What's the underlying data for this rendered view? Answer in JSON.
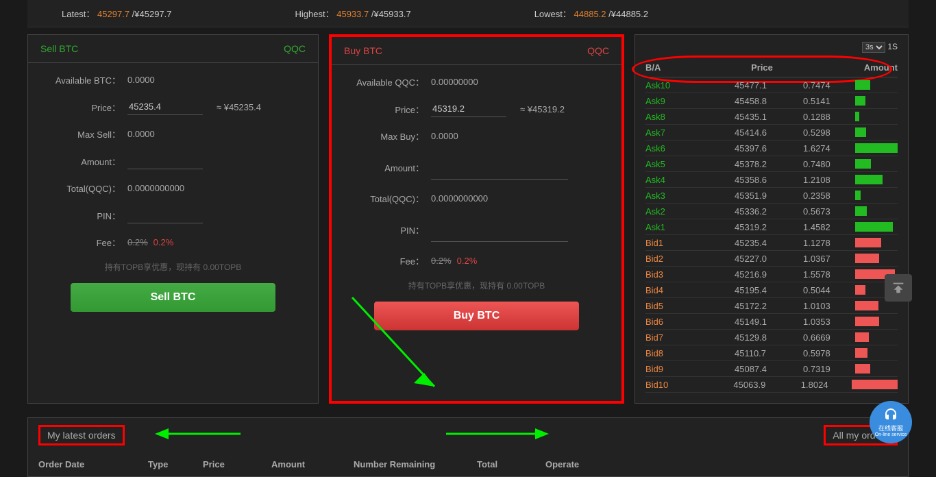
{
  "stats": {
    "latest_label": "Latest：",
    "latest_val": "45297.7",
    "latest_sub": "/¥45297.7",
    "highest_label": "Highest：",
    "highest_val": "45933.7",
    "highest_sub": "/¥45933.7",
    "lowest_label": "Lowest：",
    "lowest_val": "44885.2",
    "lowest_sub": "/¥44885.2"
  },
  "sell": {
    "title": "Sell BTC",
    "currency": "QQC",
    "available_label": "Available BTC：",
    "available_val": "0.0000",
    "price_label": "Price：",
    "price_val": "45235.4",
    "price_approx": "≈ ¥45235.4",
    "max_label": "Max Sell：",
    "max_val": "0.0000",
    "amount_label": "Amount：",
    "amount_val": "",
    "total_label": "Total(QQC)：",
    "total_val": "0.0000000000",
    "pin_label": "PIN：",
    "pin_val": "",
    "fee_label": "Fee：",
    "fee_strike": "0.2%",
    "fee_val": "0.2%",
    "note": "持有TOPB享优惠，现持有 0.00TOPB",
    "btn": "Sell BTC"
  },
  "buy": {
    "title": "Buy BTC",
    "currency": "QQC",
    "available_label": "Available QQC：",
    "available_val": "0.00000000",
    "price_label": "Price：",
    "price_val": "45319.2",
    "price_approx": "≈ ¥45319.2",
    "max_label": "Max Buy：",
    "max_val": "0.0000",
    "amount_label": "Amount：",
    "amount_val": "",
    "total_label": "Total(QQC)：",
    "total_val": "0.0000000000",
    "pin_label": "PIN：",
    "pin_val": "",
    "fee_label": "Fee：",
    "fee_strike": "0.2%",
    "fee_val": "0.2%",
    "note": "持有TOPB享优惠，现持有 0.00TOPB",
    "btn": "Buy BTC"
  },
  "orderbook": {
    "refresh": "3s",
    "refresh_suffix": "1S",
    "h1": "B/A",
    "h2": "Price",
    "h3": "Amount",
    "rows": [
      {
        "label": "Ask10",
        "price": "45477.1",
        "amount": "0.7474",
        "side": "ask",
        "bar": 22
      },
      {
        "label": "Ask9",
        "price": "45458.8",
        "amount": "0.5141",
        "side": "ask",
        "bar": 15
      },
      {
        "label": "Ask8",
        "price": "45435.1",
        "amount": "0.1288",
        "side": "ask",
        "bar": 6
      },
      {
        "label": "Ask7",
        "price": "45414.6",
        "amount": "0.5298",
        "side": "ask",
        "bar": 16
      },
      {
        "label": "Ask6",
        "price": "45397.6",
        "amount": "1.6274",
        "side": "ask",
        "bar": 62
      },
      {
        "label": "Ask5",
        "price": "45378.2",
        "amount": "0.7480",
        "side": "ask",
        "bar": 23
      },
      {
        "label": "Ask4",
        "price": "45358.6",
        "amount": "1.2108",
        "side": "ask",
        "bar": 40
      },
      {
        "label": "Ask3",
        "price": "45351.9",
        "amount": "0.2358",
        "side": "ask",
        "bar": 8
      },
      {
        "label": "Ask2",
        "price": "45336.2",
        "amount": "0.5673",
        "side": "ask",
        "bar": 17
      },
      {
        "label": "Ask1",
        "price": "45319.2",
        "amount": "1.4582",
        "side": "ask",
        "bar": 55
      },
      {
        "label": "Bid1",
        "price": "45235.4",
        "amount": "1.1278",
        "side": "bid",
        "bar": 38
      },
      {
        "label": "Bid2",
        "price": "45227.0",
        "amount": "1.0367",
        "side": "bid",
        "bar": 35
      },
      {
        "label": "Bid3",
        "price": "45216.9",
        "amount": "1.5578",
        "side": "bid",
        "bar": 58
      },
      {
        "label": "Bid4",
        "price": "45195.4",
        "amount": "0.5044",
        "side": "bid",
        "bar": 15
      },
      {
        "label": "Bid5",
        "price": "45172.2",
        "amount": "1.0103",
        "side": "bid",
        "bar": 34
      },
      {
        "label": "Bid6",
        "price": "45149.1",
        "amount": "1.0353",
        "side": "bid",
        "bar": 35
      },
      {
        "label": "Bid7",
        "price": "45129.8",
        "amount": "0.6669",
        "side": "bid",
        "bar": 20
      },
      {
        "label": "Bid8",
        "price": "45110.7",
        "amount": "0.5978",
        "side": "bid",
        "bar": 18
      },
      {
        "label": "Bid9",
        "price": "45087.4",
        "amount": "0.7319",
        "side": "bid",
        "bar": 22
      },
      {
        "label": "Bid10",
        "price": "45063.9",
        "amount": "1.8024",
        "side": "bid",
        "bar": 68
      }
    ]
  },
  "orders": {
    "tab_latest": "My latest orders",
    "tab_all": "All my orders",
    "cols": [
      "Order Date",
      "Type",
      "Price",
      "Amount",
      "Number Remaining",
      "Total",
      "Operate"
    ]
  },
  "support": {
    "line1": "在线客服",
    "line2": "On-line service"
  }
}
